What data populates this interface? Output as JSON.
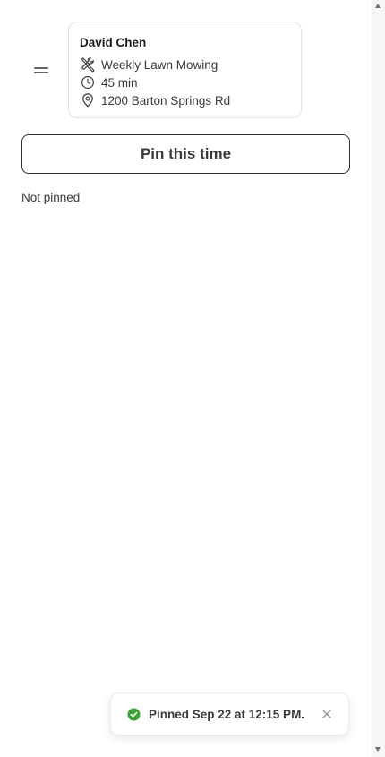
{
  "job_card": {
    "customer_name": "David Chen",
    "service": "Weekly Lawn Mowing",
    "duration": "45 min",
    "address": "1200 Barton Springs Rd",
    "icons": [
      "drag-handle-icon",
      "tools-icon",
      "clock-icon",
      "location-pin-icon"
    ]
  },
  "pin_button": {
    "label": "Pin this time"
  },
  "pin_status": "Not pinned",
  "toast": {
    "message": "Pinned Sep 22 at 12:15 PM.",
    "icon": "check-circle-icon",
    "close_icon": "close-icon"
  },
  "colors": {
    "success": "#3aa335",
    "text": "#3a3a3a",
    "card_border": "#e3e3e3",
    "button_border": "#2f2f2f"
  }
}
